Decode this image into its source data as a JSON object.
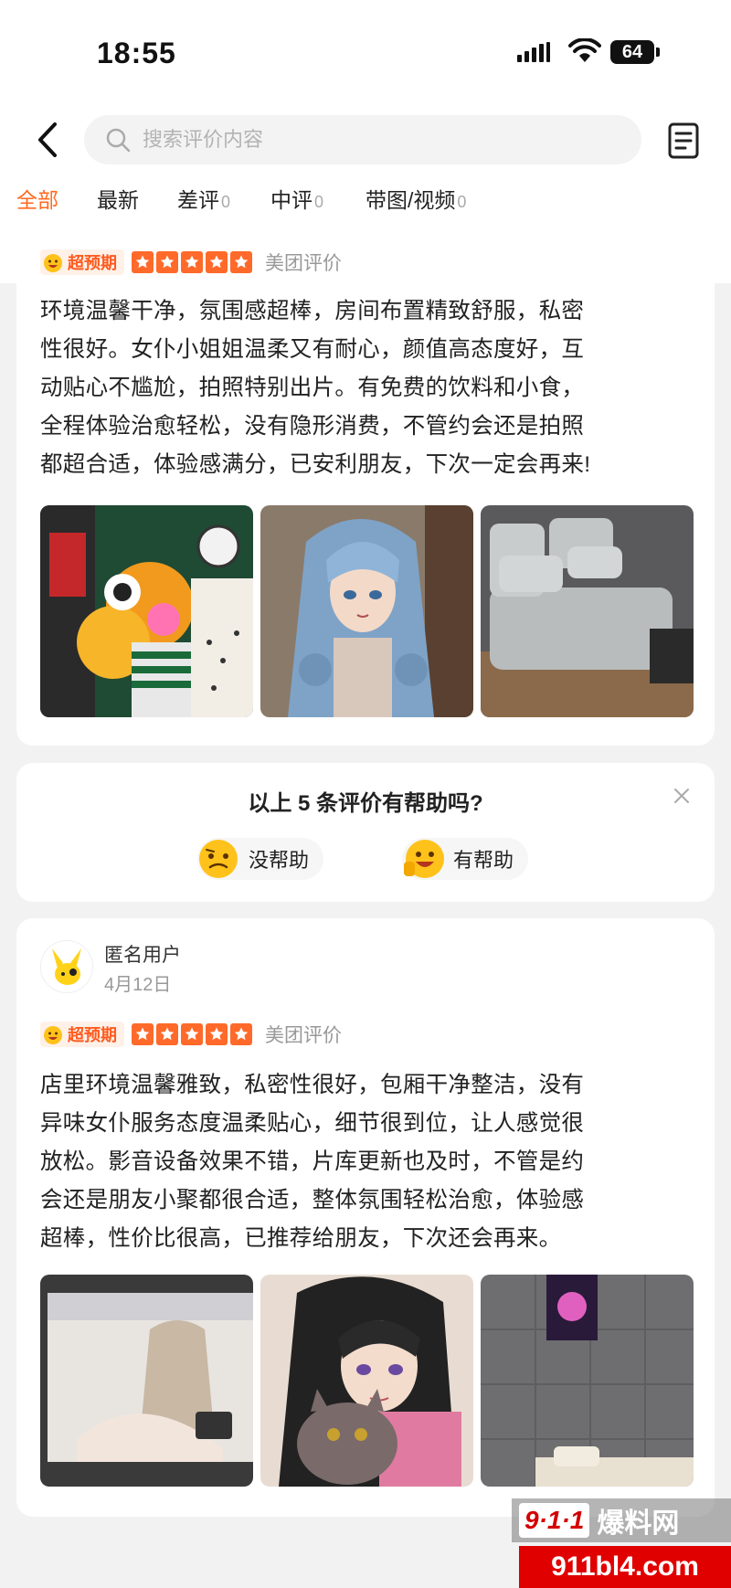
{
  "status": {
    "time": "18:55",
    "battery": "64"
  },
  "search": {
    "placeholder": "搜索评价内容"
  },
  "tabs": [
    {
      "label": "全部",
      "count": ""
    },
    {
      "label": "最新",
      "count": ""
    },
    {
      "label": "差评",
      "count": "0"
    },
    {
      "label": "中评",
      "count": "0"
    },
    {
      "label": "带图/视频",
      "count": "0"
    }
  ],
  "review1": {
    "badge": "超预期",
    "rating": 5,
    "source": "美团评价",
    "lines": [
      "环境温馨干净，氛围感超棒，房间布置精致舒服，私密",
      "性很好。女仆小姐姐温柔又有耐心，颜值高态度好，互",
      "动贴心不尴尬，拍照特别出片。有免费的饮料和小食，",
      "全程体验治愈轻松，没有隐形消费，不管约会还是拍照",
      "都超合适，体验感满分，已安利朋友，下次一定会再来!"
    ]
  },
  "helpful": {
    "question": "以上 5 条评价有帮助吗?",
    "no_label": "没帮助",
    "yes_label": "有帮助"
  },
  "review2": {
    "user": "匿名用户",
    "date": "4月12日",
    "badge": "超预期",
    "rating": 5,
    "source": "美团评价",
    "lines": [
      "店里环境温馨雅致，私密性很好，包厢干净整洁，没有",
      "异味女仆服务态度温柔贴心，细节很到位，让人感觉很",
      "放松。影音设备效果不错，片库更新也及时，不管是约",
      "会还是朋友小聚都很合适，整体氛围轻松治愈，体验感",
      "超棒，性价比很高，已推荐给朋友，下次还会再来。"
    ]
  },
  "watermark": {
    "logo": "9·1·1",
    "name": "爆料网",
    "url": "911bl4.com"
  },
  "colors": {
    "accent": "#ff6a1f",
    "star": "#ff6a2a"
  }
}
